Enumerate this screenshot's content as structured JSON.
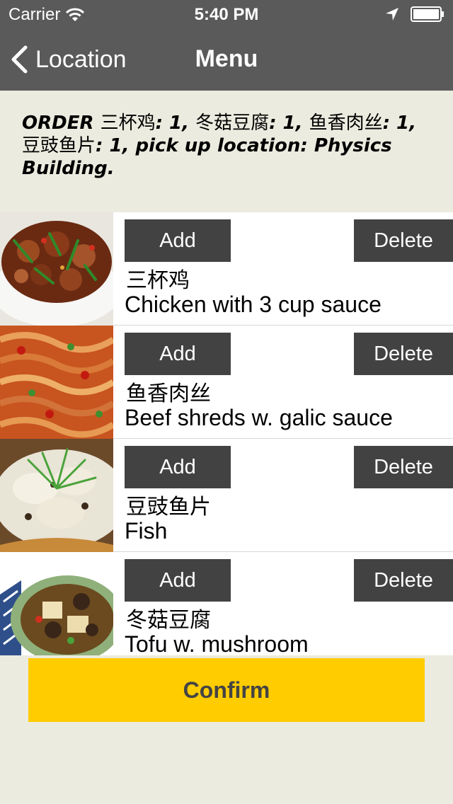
{
  "status_bar": {
    "carrier": "Carrier",
    "time": "5:40 PM"
  },
  "nav": {
    "back_label": "Location",
    "title": "Menu"
  },
  "order": {
    "prefix": "ORDER",
    "items": [
      {
        "name": "三杯鸡",
        "sep": ": ",
        "qty": "1",
        "after": ", "
      },
      {
        "name": "冬菇豆腐",
        "sep": ": ",
        "qty": "1",
        "after": ", "
      },
      {
        "name": "鱼香肉丝",
        "sep": ": ",
        "qty": "1",
        "after": ", "
      },
      {
        "name": "豆豉鱼片",
        "sep": ": ",
        "qty": "1",
        "after": ", "
      }
    ],
    "pickup_label": "pick up location: ",
    "pickup_location": "Physics Building",
    "suffix": "."
  },
  "menu": {
    "add_label": "Add",
    "delete_label": "Delete",
    "items": [
      {
        "name_cn": "三杯鸡",
        "name_en": "Chicken with 3 cup sauce",
        "image_icon": "chicken-dish-photo"
      },
      {
        "name_cn": "鱼香肉丝",
        "name_en": "Beef shreds w. galic sauce",
        "image_icon": "beef-shreds-dish-photo"
      },
      {
        "name_cn": "豆豉鱼片",
        "name_en": "Fish",
        "image_icon": "fish-dish-photo"
      },
      {
        "name_cn": "冬菇豆腐",
        "name_en": "Tofu w. mushroom",
        "image_icon": "tofu-dish-photo"
      }
    ]
  },
  "confirm_label": "Confirm",
  "colors": {
    "nav_bar": "#5a5a5a",
    "background": "#ebebdf",
    "button": "#424242",
    "confirm": "#ffcc00"
  }
}
